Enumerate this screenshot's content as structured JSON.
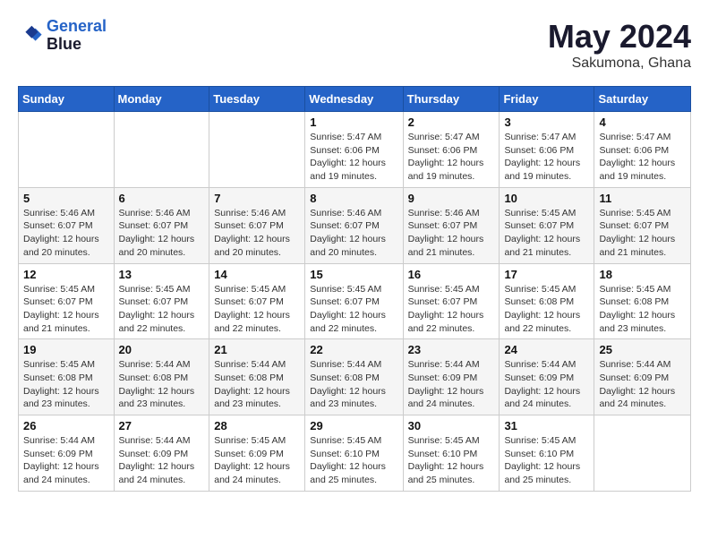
{
  "logo": {
    "line1": "General",
    "line2": "Blue"
  },
  "title": {
    "month_year": "May 2024",
    "location": "Sakumona, Ghana"
  },
  "weekdays": [
    "Sunday",
    "Monday",
    "Tuesday",
    "Wednesday",
    "Thursday",
    "Friday",
    "Saturday"
  ],
  "weeks": [
    [
      {
        "day": "",
        "info": ""
      },
      {
        "day": "",
        "info": ""
      },
      {
        "day": "",
        "info": ""
      },
      {
        "day": "1",
        "info": "Sunrise: 5:47 AM\nSunset: 6:06 PM\nDaylight: 12 hours\nand 19 minutes."
      },
      {
        "day": "2",
        "info": "Sunrise: 5:47 AM\nSunset: 6:06 PM\nDaylight: 12 hours\nand 19 minutes."
      },
      {
        "day": "3",
        "info": "Sunrise: 5:47 AM\nSunset: 6:06 PM\nDaylight: 12 hours\nand 19 minutes."
      },
      {
        "day": "4",
        "info": "Sunrise: 5:47 AM\nSunset: 6:06 PM\nDaylight: 12 hours\nand 19 minutes."
      }
    ],
    [
      {
        "day": "5",
        "info": "Sunrise: 5:46 AM\nSunset: 6:07 PM\nDaylight: 12 hours\nand 20 minutes."
      },
      {
        "day": "6",
        "info": "Sunrise: 5:46 AM\nSunset: 6:07 PM\nDaylight: 12 hours\nand 20 minutes."
      },
      {
        "day": "7",
        "info": "Sunrise: 5:46 AM\nSunset: 6:07 PM\nDaylight: 12 hours\nand 20 minutes."
      },
      {
        "day": "8",
        "info": "Sunrise: 5:46 AM\nSunset: 6:07 PM\nDaylight: 12 hours\nand 20 minutes."
      },
      {
        "day": "9",
        "info": "Sunrise: 5:46 AM\nSunset: 6:07 PM\nDaylight: 12 hours\nand 21 minutes."
      },
      {
        "day": "10",
        "info": "Sunrise: 5:45 AM\nSunset: 6:07 PM\nDaylight: 12 hours\nand 21 minutes."
      },
      {
        "day": "11",
        "info": "Sunrise: 5:45 AM\nSunset: 6:07 PM\nDaylight: 12 hours\nand 21 minutes."
      }
    ],
    [
      {
        "day": "12",
        "info": "Sunrise: 5:45 AM\nSunset: 6:07 PM\nDaylight: 12 hours\nand 21 minutes."
      },
      {
        "day": "13",
        "info": "Sunrise: 5:45 AM\nSunset: 6:07 PM\nDaylight: 12 hours\nand 22 minutes."
      },
      {
        "day": "14",
        "info": "Sunrise: 5:45 AM\nSunset: 6:07 PM\nDaylight: 12 hours\nand 22 minutes."
      },
      {
        "day": "15",
        "info": "Sunrise: 5:45 AM\nSunset: 6:07 PM\nDaylight: 12 hours\nand 22 minutes."
      },
      {
        "day": "16",
        "info": "Sunrise: 5:45 AM\nSunset: 6:07 PM\nDaylight: 12 hours\nand 22 minutes."
      },
      {
        "day": "17",
        "info": "Sunrise: 5:45 AM\nSunset: 6:08 PM\nDaylight: 12 hours\nand 22 minutes."
      },
      {
        "day": "18",
        "info": "Sunrise: 5:45 AM\nSunset: 6:08 PM\nDaylight: 12 hours\nand 23 minutes."
      }
    ],
    [
      {
        "day": "19",
        "info": "Sunrise: 5:45 AM\nSunset: 6:08 PM\nDaylight: 12 hours\nand 23 minutes."
      },
      {
        "day": "20",
        "info": "Sunrise: 5:44 AM\nSunset: 6:08 PM\nDaylight: 12 hours\nand 23 minutes."
      },
      {
        "day": "21",
        "info": "Sunrise: 5:44 AM\nSunset: 6:08 PM\nDaylight: 12 hours\nand 23 minutes."
      },
      {
        "day": "22",
        "info": "Sunrise: 5:44 AM\nSunset: 6:08 PM\nDaylight: 12 hours\nand 23 minutes."
      },
      {
        "day": "23",
        "info": "Sunrise: 5:44 AM\nSunset: 6:09 PM\nDaylight: 12 hours\nand 24 minutes."
      },
      {
        "day": "24",
        "info": "Sunrise: 5:44 AM\nSunset: 6:09 PM\nDaylight: 12 hours\nand 24 minutes."
      },
      {
        "day": "25",
        "info": "Sunrise: 5:44 AM\nSunset: 6:09 PM\nDaylight: 12 hours\nand 24 minutes."
      }
    ],
    [
      {
        "day": "26",
        "info": "Sunrise: 5:44 AM\nSunset: 6:09 PM\nDaylight: 12 hours\nand 24 minutes."
      },
      {
        "day": "27",
        "info": "Sunrise: 5:44 AM\nSunset: 6:09 PM\nDaylight: 12 hours\nand 24 minutes."
      },
      {
        "day": "28",
        "info": "Sunrise: 5:45 AM\nSunset: 6:09 PM\nDaylight: 12 hours\nand 24 minutes."
      },
      {
        "day": "29",
        "info": "Sunrise: 5:45 AM\nSunset: 6:10 PM\nDaylight: 12 hours\nand 25 minutes."
      },
      {
        "day": "30",
        "info": "Sunrise: 5:45 AM\nSunset: 6:10 PM\nDaylight: 12 hours\nand 25 minutes."
      },
      {
        "day": "31",
        "info": "Sunrise: 5:45 AM\nSunset: 6:10 PM\nDaylight: 12 hours\nand 25 minutes."
      },
      {
        "day": "",
        "info": ""
      }
    ]
  ]
}
